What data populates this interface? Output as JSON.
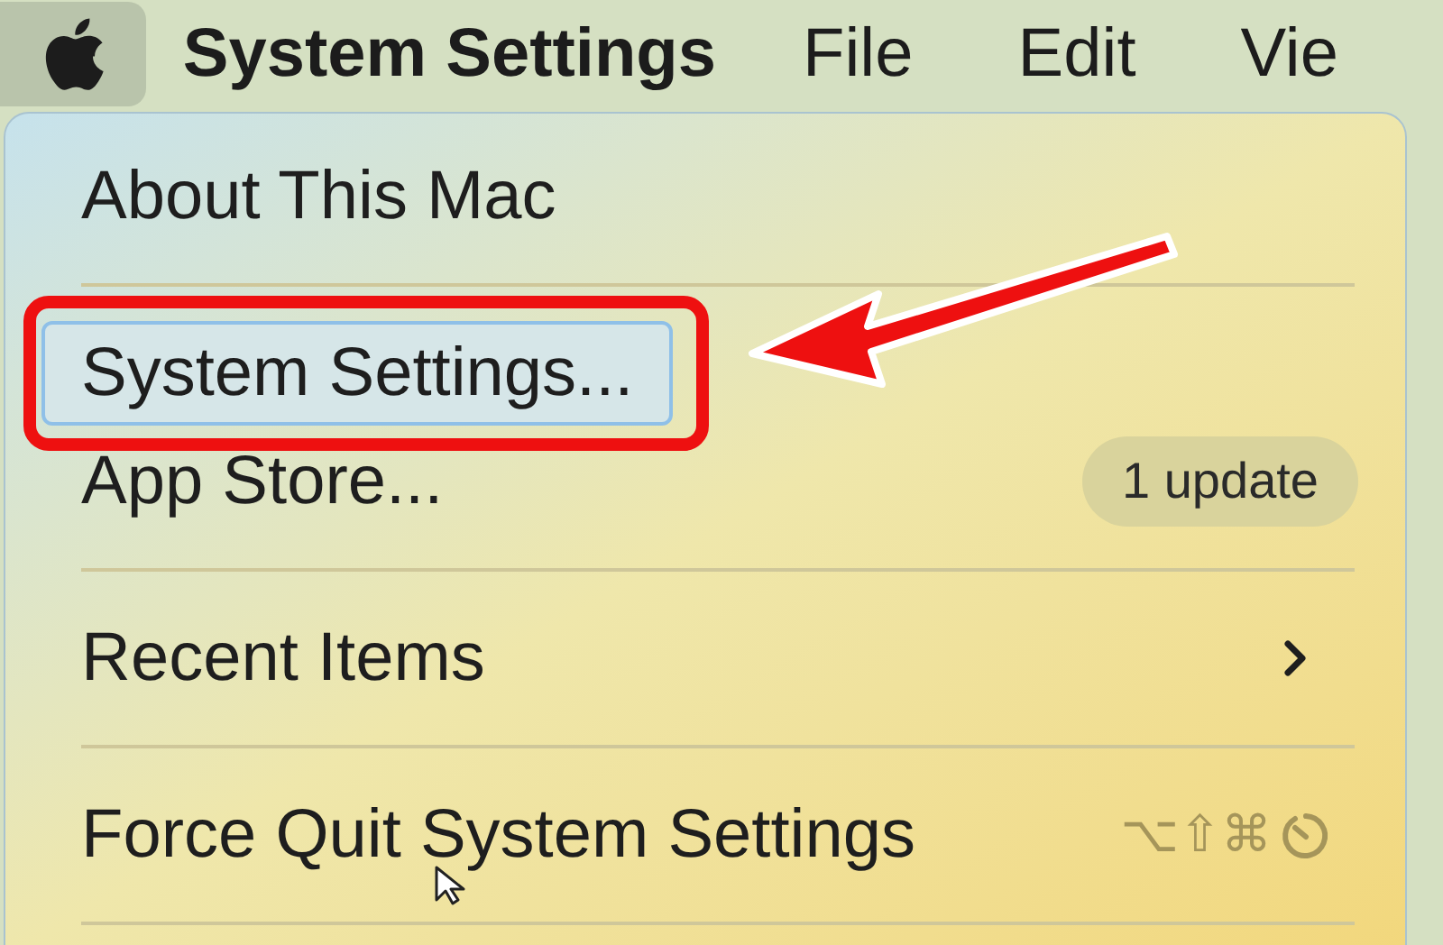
{
  "menu_bar": {
    "apple_open": true,
    "items": [
      {
        "label": "System Settings",
        "kind": "app"
      },
      {
        "label": "File",
        "kind": "menu"
      },
      {
        "label": "Edit",
        "kind": "menu"
      },
      {
        "label": "Vie",
        "kind": "menu"
      }
    ]
  },
  "apple_menu": {
    "items": [
      {
        "kind": "item",
        "label": "About This Mac",
        "selected": false,
        "annotated": false
      },
      {
        "kind": "separator"
      },
      {
        "kind": "item",
        "label": "System Settings...",
        "selected": true,
        "annotated": true
      },
      {
        "kind": "item",
        "label": "App Store...",
        "selected": false,
        "annotated": false,
        "badge": "1 update"
      },
      {
        "kind": "separator"
      },
      {
        "kind": "item",
        "label": "Recent Items",
        "selected": false,
        "annotated": false,
        "submenu": true
      },
      {
        "kind": "separator"
      },
      {
        "kind": "item",
        "label": "Force Quit System Settings",
        "selected": false,
        "annotated": false,
        "shortcut": "⌥⇧⌘"
      },
      {
        "kind": "separator"
      }
    ]
  }
}
